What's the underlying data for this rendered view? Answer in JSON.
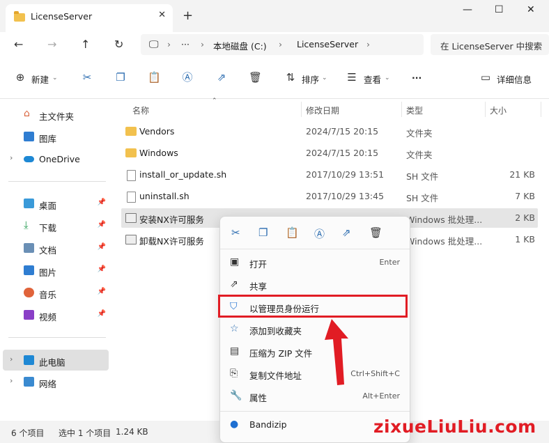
{
  "window": {
    "tab_title": "LicenseServer",
    "tab_close": "✕",
    "new_tab": "+",
    "minimize": "—",
    "maximize": "☐",
    "close": "✕"
  },
  "address": {
    "root_sep": "›",
    "more": "···",
    "crumbs": [
      "本地磁盘 (C:)",
      "LicenseServer"
    ],
    "sep": "›",
    "search_placeholder": "在 LicenseServer 中搜索"
  },
  "toolbar": {
    "new_label": "新建",
    "sort_label": "排序",
    "view_label": "查看",
    "more": "···",
    "details_label": "详细信息"
  },
  "sidebar": {
    "items": [
      {
        "label": "主文件夹"
      },
      {
        "label": "图库"
      },
      {
        "label": "OneDrive"
      },
      {
        "label": "桌面"
      },
      {
        "label": "下载"
      },
      {
        "label": "文档"
      },
      {
        "label": "图片"
      },
      {
        "label": "音乐"
      },
      {
        "label": "视频"
      },
      {
        "label": "此电脑"
      },
      {
        "label": "网络"
      }
    ]
  },
  "columns": {
    "name": "名称",
    "date": "修改日期",
    "type": "类型",
    "size": "大小"
  },
  "files": [
    {
      "name": "Vendors",
      "date": "2024/7/15 20:15",
      "type": "文件夹",
      "size": ""
    },
    {
      "name": "Windows",
      "date": "2024/7/15 20:15",
      "type": "文件夹",
      "size": ""
    },
    {
      "name": "install_or_update.sh",
      "date": "2017/10/29 13:51",
      "type": "SH 文件",
      "size": "21 KB"
    },
    {
      "name": "uninstall.sh",
      "date": "2017/10/29 13:45",
      "type": "SH 文件",
      "size": "7 KB"
    },
    {
      "name": "安装NX许可服务",
      "date": "",
      "type": "Windows 批处理...",
      "size": "2 KB"
    },
    {
      "name": "卸载NX许可服务",
      "date": "",
      "type": "Windows 批处理...",
      "size": "1 KB"
    }
  ],
  "context_menu": {
    "items": [
      {
        "label": "打开",
        "shortcut": "Enter"
      },
      {
        "label": "共享",
        "shortcut": ""
      },
      {
        "label": "以管理员身份运行",
        "shortcut": ""
      },
      {
        "label": "添加到收藏夹",
        "shortcut": ""
      },
      {
        "label": "压缩为 ZIP 文件",
        "shortcut": ""
      },
      {
        "label": "复制文件地址",
        "shortcut": "Ctrl+Shift+C"
      },
      {
        "label": "属性",
        "shortcut": "Alt+Enter"
      },
      {
        "label": "Bandizip",
        "shortcut": ""
      }
    ]
  },
  "status": {
    "count": "6 个项目",
    "selected": "选中 1 个项目",
    "size": "1.24 KB"
  },
  "watermark": "zixueLiuLiu.com",
  "colors": {
    "accent": "#2b6cb0",
    "highlight": "#e11c24",
    "folder": "#f2c14e"
  }
}
